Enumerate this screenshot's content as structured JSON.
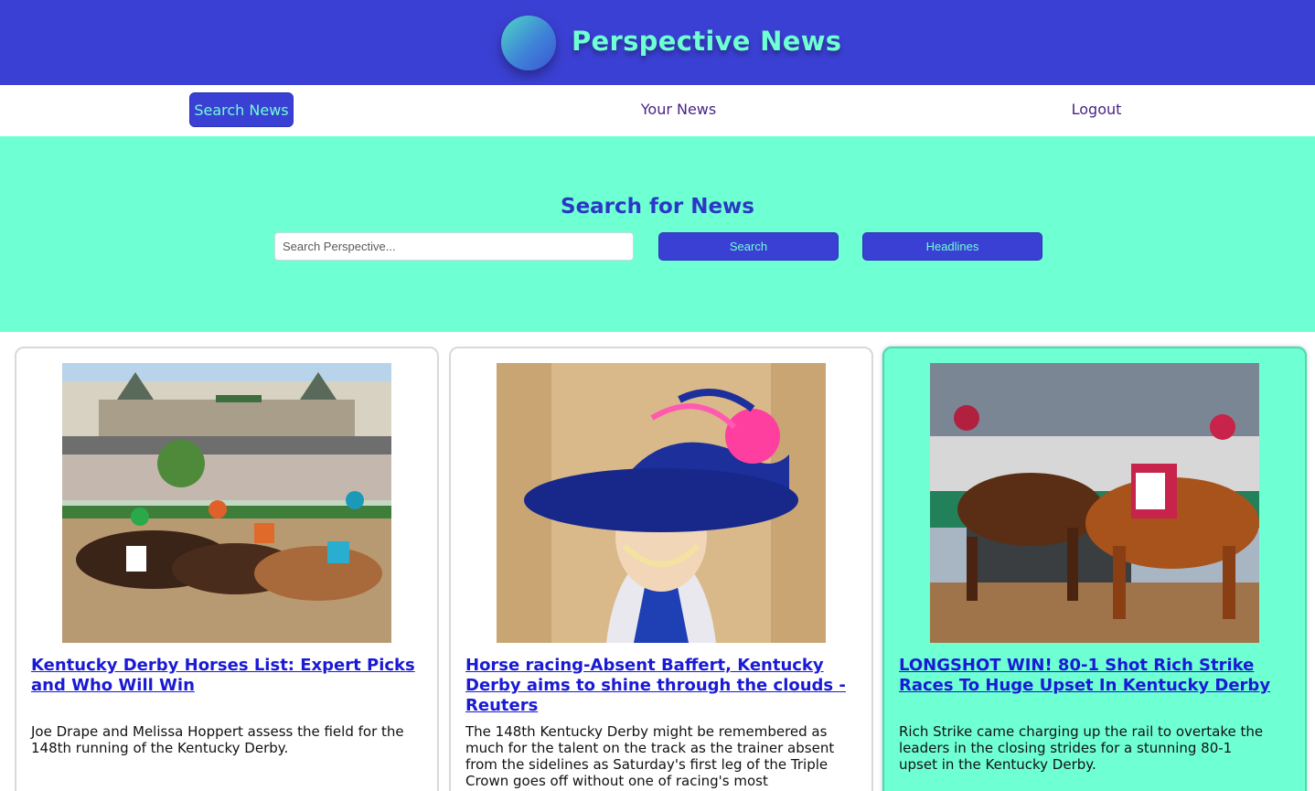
{
  "header": {
    "title": "Perspective News",
    "logo_icon": "gradient-circle-logo"
  },
  "nav": {
    "items": [
      {
        "label": "Search News",
        "active": true
      },
      {
        "label": "Your News",
        "active": false
      },
      {
        "label": "Logout",
        "active": false
      }
    ]
  },
  "search": {
    "title": "Search for News",
    "placeholder": "Search Perspective...",
    "value": "",
    "search_button": "Search",
    "headlines_button": "Headlines"
  },
  "articles": [
    {
      "title": "Kentucky Derby Horses List: Expert Picks and Who Will Win",
      "description": "Joe Drape and Melissa Hoppert assess the field for the 148th running of the Kentucky Derby.",
      "image": "horses-racing-at-churchill-downs-photo",
      "highlighted": false
    },
    {
      "title": "Horse racing-Absent Baffert, Kentucky Derby aims to shine through the clouds - Reuters",
      "description": "The 148th Kentucky Derby might be remembered as much for the talent on the track as the trainer absent from the sidelines as Saturday's first leg of the Triple Crown goes off without one of racing's most recognizable figures.",
      "image": "woman-in-derby-hat-photo",
      "highlighted": false
    },
    {
      "title": "LONGSHOT WIN! 80-1 Shot Rich Strike Races To Huge Upset In Kentucky Derby",
      "description": "Rich Strike came charging up the rail to overtake the leaders in the closing strides for a stunning 80-1 upset in the Kentucky Derby.",
      "image": "rich-strike-winning-photo",
      "highlighted": true
    }
  ],
  "colors": {
    "primary": "#3b40d4",
    "accent": "#6effd3",
    "link": "#1a1ad6",
    "nav_text": "#4a2384"
  }
}
